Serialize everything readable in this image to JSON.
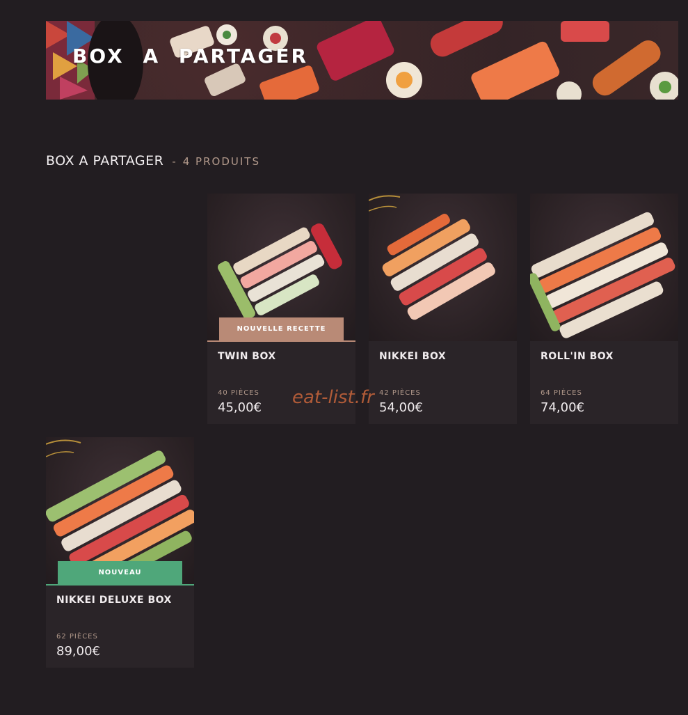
{
  "banner": {
    "title": "BOX A PARTAGER"
  },
  "section": {
    "title": "BOX A PARTAGER",
    "separator": "-",
    "count": "4 PRODUITS"
  },
  "products": [
    {
      "name": "TWIN BOX",
      "pieces": "40 PIÈCES",
      "price": "45,00€",
      "badge": "NOUVELLE RECETTE",
      "badge_color": "#b98a76"
    },
    {
      "name": "NIKKEI BOX",
      "pieces": "42 PIÈCES",
      "price": "54,00€"
    },
    {
      "name": "ROLL'IN BOX",
      "pieces": "64 PIÈCES",
      "price": "74,00€"
    },
    {
      "name": "NIKKEI DELUXE BOX",
      "pieces": "62 PIÈCES",
      "price": "89,00€",
      "badge": "NOUVEAU",
      "badge_color": "#4fa77a"
    }
  ],
  "watermark": "eat-list.fr",
  "colors": {
    "background": "#221d21",
    "card": "#2a2428",
    "accent_copper": "#b39a8c"
  }
}
